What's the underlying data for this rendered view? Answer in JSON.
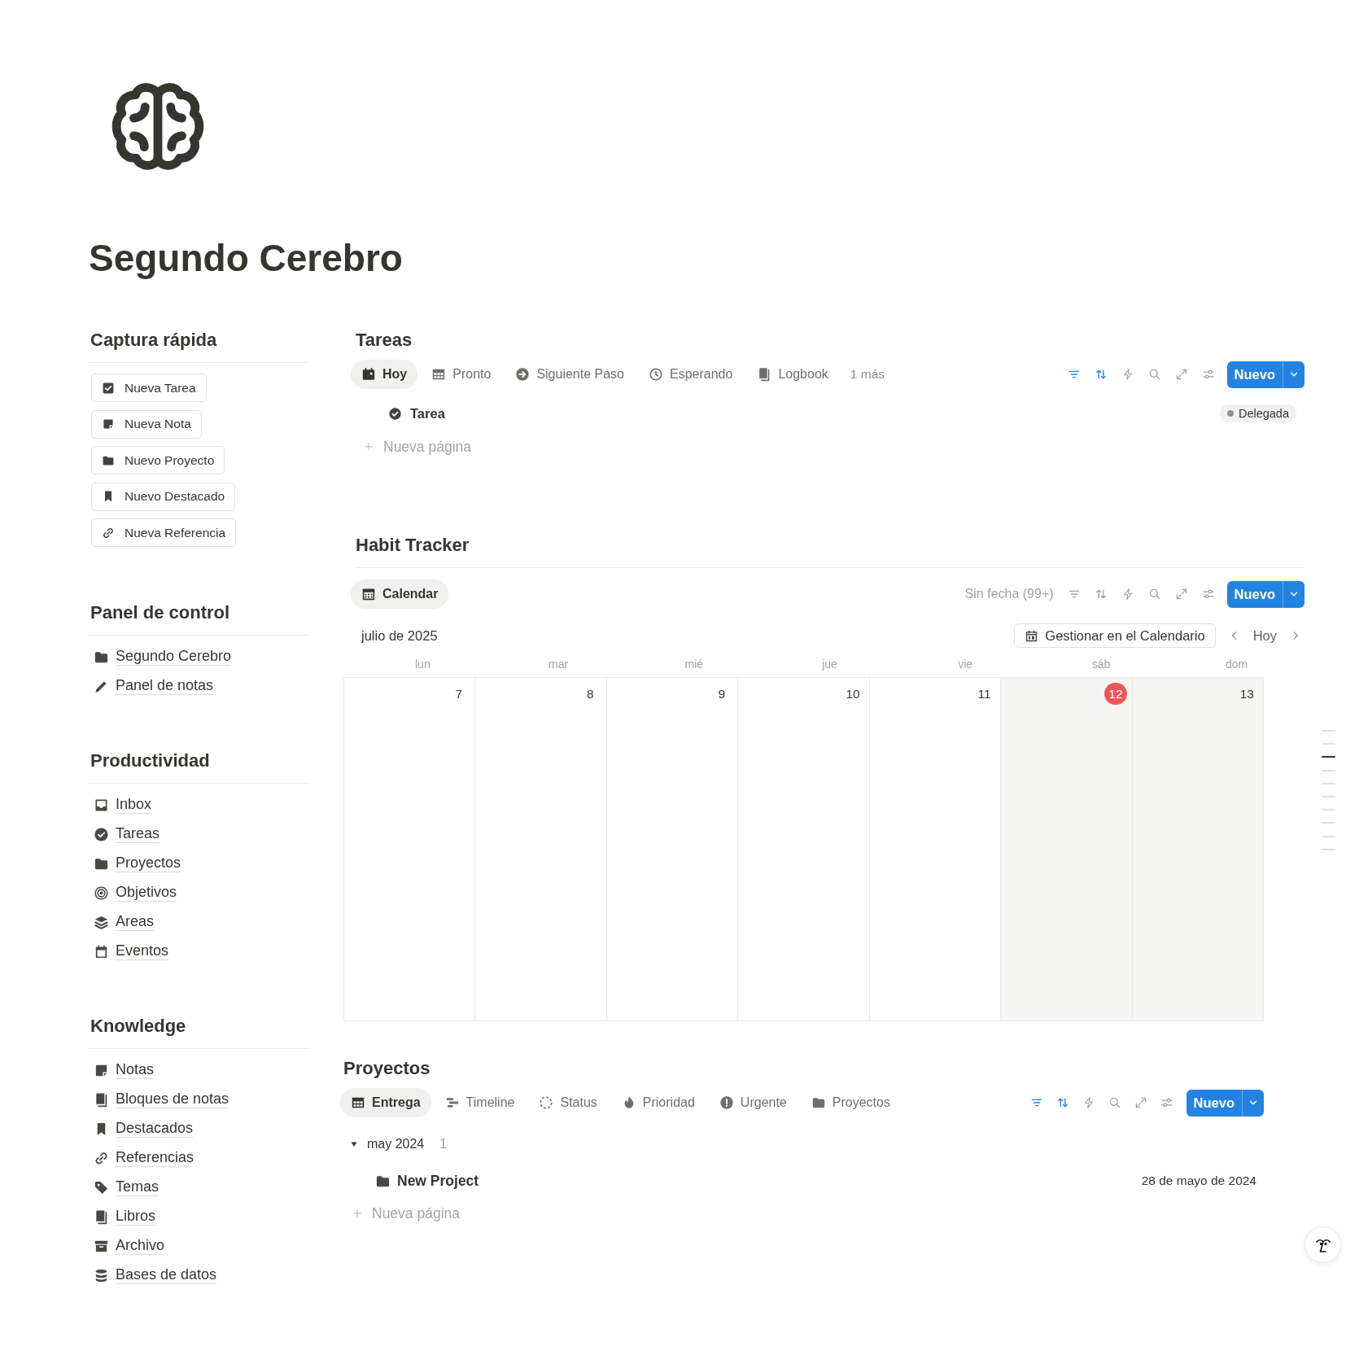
{
  "page": {
    "title": "Segundo Cerebro"
  },
  "sidebar": [
    {
      "title": "Captura rápida",
      "kind": "buttons",
      "items": [
        "Nueva Tarea",
        "Nueva Nota",
        "Nuevo Proyecto",
        "Nuevo Destacado",
        "Nueva Referencia"
      ]
    },
    {
      "title": "Panel de control",
      "kind": "links",
      "items": [
        "Segundo Cerebro",
        "Panel de notas"
      ]
    },
    {
      "title": "Productividad",
      "kind": "links",
      "items": [
        "Inbox",
        "Tareas",
        "Proyectos",
        "Objetivos",
        "Areas",
        "Eventos"
      ]
    },
    {
      "title": "Knowledge",
      "kind": "links",
      "items": [
        "Notas",
        "Bloques de notas",
        "Destacados",
        "Referencias",
        "Temas",
        "Libros",
        "Archivo",
        "Bases de datos"
      ]
    }
  ],
  "tareas": {
    "title": "Tareas",
    "views": [
      {
        "label": "Hoy",
        "selected": true
      },
      {
        "label": "Pronto",
        "selected": false
      },
      {
        "label": "Siguiente Paso",
        "selected": false
      },
      {
        "label": "Esperando",
        "selected": false
      },
      {
        "label": "Logbook",
        "selected": false
      }
    ],
    "more_views": "1 más",
    "filter_active": true,
    "sort_active": true,
    "new_button": "Nuevo",
    "rows": [
      {
        "title": "Tarea",
        "status": {
          "label": "Delegada",
          "color": "#91918e"
        }
      }
    ],
    "add_row": "Nueva página"
  },
  "habit_tracker": {
    "title": "Habit Tracker",
    "views": [
      {
        "label": "Calendar",
        "selected": true
      }
    ],
    "no_date": "Sin fecha (99+)",
    "filter_active": false,
    "sort_active": false,
    "new_button": "Nuevo",
    "month": "julio de 2025",
    "manage_button": "Gestionar en el Calendario",
    "today_button": "Hoy",
    "weekdays": [
      "lun",
      "mar",
      "mié",
      "jue",
      "vie",
      "sáb",
      "dom"
    ],
    "days": [
      {
        "label": "7",
        "today": false
      },
      {
        "label": "8",
        "today": false
      },
      {
        "label": "9",
        "today": false
      },
      {
        "label": "10",
        "today": false
      },
      {
        "label": "11",
        "today": false
      },
      {
        "label": "12",
        "today": true
      },
      {
        "label": "13",
        "today": false
      }
    ]
  },
  "proyectos": {
    "title": "Proyectos",
    "views": [
      {
        "label": "Entrega",
        "selected": true
      },
      {
        "label": "Timeline",
        "selected": false
      },
      {
        "label": "Status",
        "selected": false
      },
      {
        "label": "Prioridad",
        "selected": false
      },
      {
        "label": "Urgente",
        "selected": false
      },
      {
        "label": "Proyectos",
        "selected": false
      }
    ],
    "filter_active": true,
    "sort_active": true,
    "new_button": "Nuevo",
    "groups": [
      {
        "label": "may 2024",
        "count": "1",
        "expanded": true,
        "rows": [
          {
            "title": "New Project",
            "date": "28 de mayo de 2024"
          }
        ]
      }
    ],
    "add_row": "Nueva página"
  },
  "outline": [
    {
      "selected": false
    },
    {
      "selected": false
    },
    {
      "selected": true
    },
    {
      "selected": false
    },
    {
      "selected": false
    },
    {
      "selected": false
    },
    {
      "selected": false
    },
    {
      "selected": false
    },
    {
      "selected": false
    },
    {
      "selected": false
    }
  ]
}
